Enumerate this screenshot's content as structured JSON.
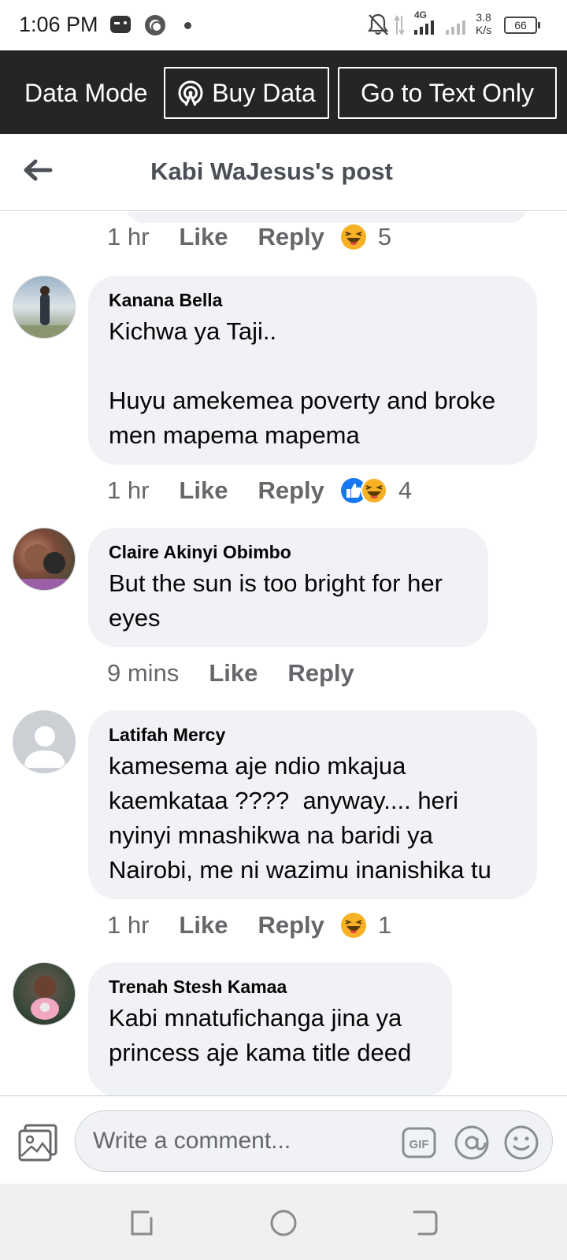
{
  "status_bar": {
    "time": "1:06 PM",
    "network": "4G",
    "speed": "3.8\nK/s",
    "battery": "66"
  },
  "data_bar": {
    "mode_label": "Data Mode",
    "buy_data": "Buy Data",
    "text_only": "Go to Text Only"
  },
  "header": {
    "title": "Kabi WaJesus's post"
  },
  "comments": [
    {
      "meta": {
        "time": "1 hr",
        "like": "Like",
        "reply": "Reply",
        "reactions": [
          "haha"
        ],
        "count": "5"
      }
    },
    {
      "author": "Kanana Bella",
      "text": "Kichwa ya Taji..\n\nHuyu amekemea poverty and broke men mapema mapema",
      "meta": {
        "time": "1 hr",
        "like": "Like",
        "reply": "Reply",
        "reactions": [
          "like",
          "haha"
        ],
        "count": "4"
      }
    },
    {
      "author": "Claire Akinyi Obimbo",
      "text": "But the sun is too bright for her eyes",
      "meta": {
        "time": "9 mins",
        "like": "Like",
        "reply": "Reply"
      }
    },
    {
      "author": "Latifah Mercy",
      "text": "kamesema aje ndio mkajua kaemkataa ????  anyway.... heri nyinyi mnashikwa na baridi ya Nairobi, me ni wazimu inanishika tu",
      "meta": {
        "time": "1 hr",
        "like": "Like",
        "reply": "Reply",
        "reactions": [
          "haha"
        ],
        "count": "1"
      }
    },
    {
      "author": "Trenah Stesh Kamaa",
      "text": "Kabi mnatufichanga jina ya princess aje kama title deed"
    }
  ],
  "composer": {
    "placeholder": "Write a comment..."
  },
  "colors": {
    "data_bar_bg": "#242526",
    "bubble_bg": "#f0f2f5",
    "meta_text": "#65676b",
    "like_blue": "#1877f2",
    "haha_yellow": "#f7b125"
  }
}
